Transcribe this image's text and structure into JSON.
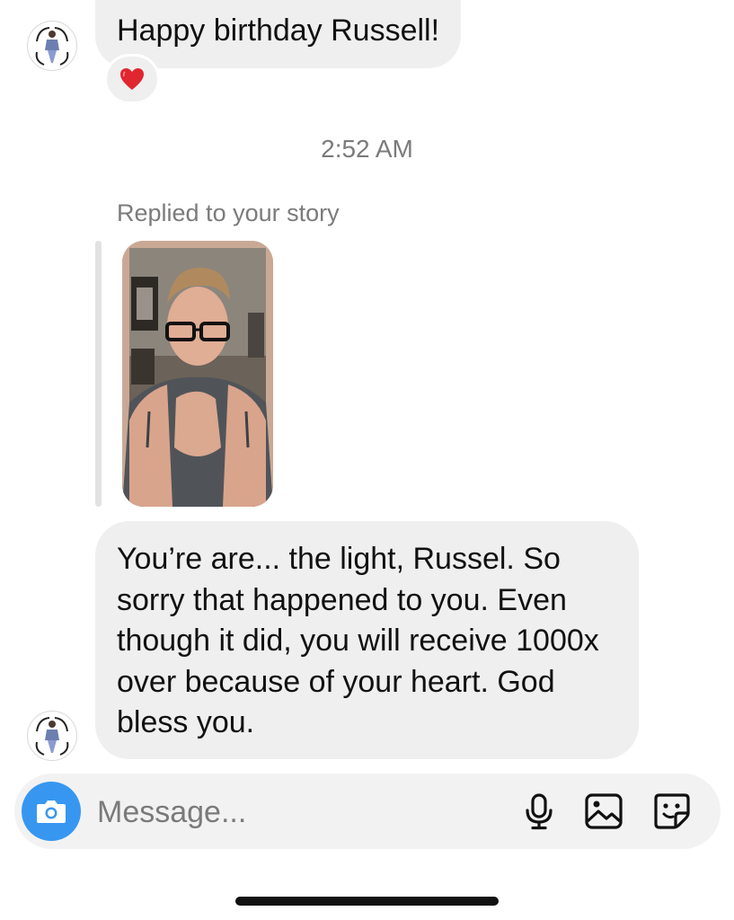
{
  "messages": [
    {
      "text": "Happy birthday Russell!",
      "reaction": "heart-emoji",
      "avatar": "sender-avatar"
    },
    {
      "text": "You’re are... the light, Russel. So sorry that happened to you. Even though it did, you will receive 1000x over because of your heart. God bless you.",
      "avatar": "sender-avatar"
    }
  ],
  "timestamp": "2:52 AM",
  "story_reply": {
    "label": "Replied to your story",
    "thumbnail": "story-thumbnail"
  },
  "composer": {
    "placeholder": "Message...",
    "icons": [
      "camera-icon",
      "microphone-icon",
      "gallery-icon",
      "sticker-icon"
    ],
    "camera_color": "#3797f0"
  },
  "colors": {
    "bubble": "#efefef",
    "meta_text": "#7b7b7b",
    "composer_bg": "#f2f2f2"
  }
}
